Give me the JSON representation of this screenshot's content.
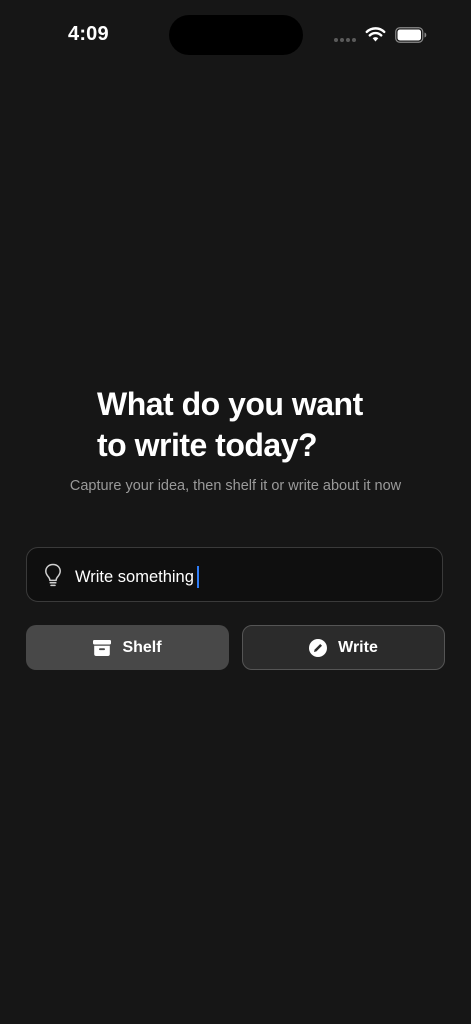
{
  "status_bar": {
    "time": "4:09"
  },
  "icons": {
    "wifi": "wifi-icon",
    "battery": "battery-icon",
    "idea": "lightbulb-icon",
    "shelf": "archive-box-icon",
    "write": "pencil-circle-icon"
  },
  "main": {
    "headline_line1": "What do you want",
    "headline_line2": "to write today?",
    "subtitle": "Capture your idea, then shelf it or write about it now"
  },
  "input": {
    "value": "Write something"
  },
  "buttons": {
    "shelf_label": "Shelf",
    "write_label": "Write"
  },
  "colors": {
    "background": "#161616",
    "caret": "#2f7df6",
    "shelf_button": "#484848",
    "write_button": "#2b2b2b"
  }
}
